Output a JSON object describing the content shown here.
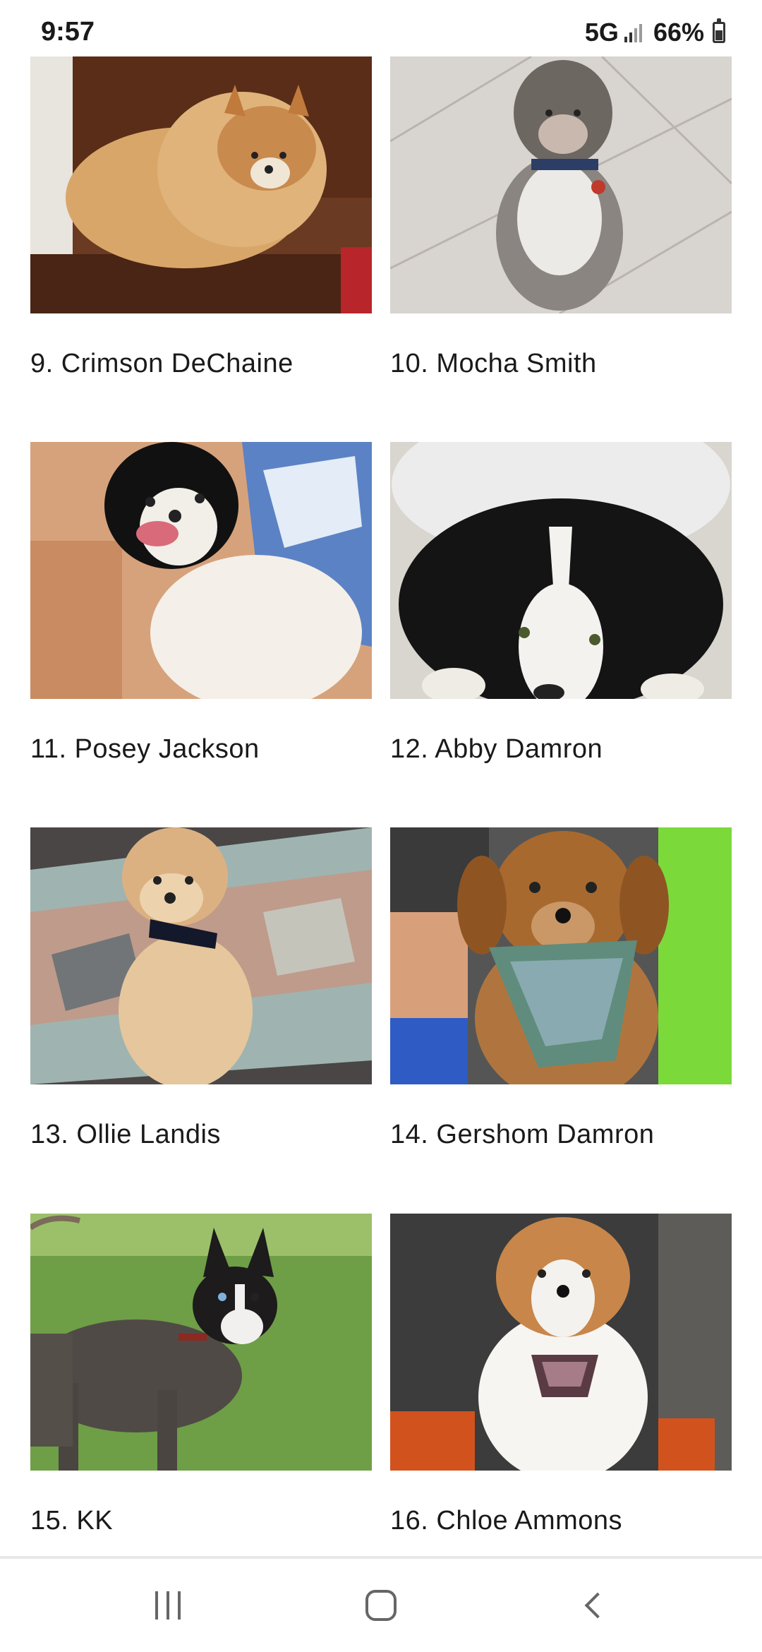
{
  "status_bar": {
    "time": "9:57",
    "network": "5G",
    "battery": "66%"
  },
  "pets": [
    {
      "caption": "9. Crimson DeChaine",
      "photo": "pomeranian on wood floor"
    },
    {
      "caption": "10. Mocha Smith",
      "photo": "grey doodle on tile floor"
    },
    {
      "caption": "11. Posey Jackson",
      "photo": "black and white papillon on blue pillow"
    },
    {
      "caption": "12. Abby Damron",
      "photo": "black and white fluffy dog closeup"
    },
    {
      "caption": "13. Ollie Landis",
      "photo": "cream poodle with bow tie on rug"
    },
    {
      "caption": "14. Gershom Damron",
      "photo": "golden puppy with plaid bandana"
    },
    {
      "caption": "15. KK",
      "photo": "grey dog on grass"
    },
    {
      "caption": "16. Chloe Ammons",
      "photo": "sheltie with bandana in vehicle"
    }
  ],
  "nav": {
    "recents_icon": "recents-icon",
    "home_icon": "home-icon",
    "back_icon": "back-icon"
  }
}
